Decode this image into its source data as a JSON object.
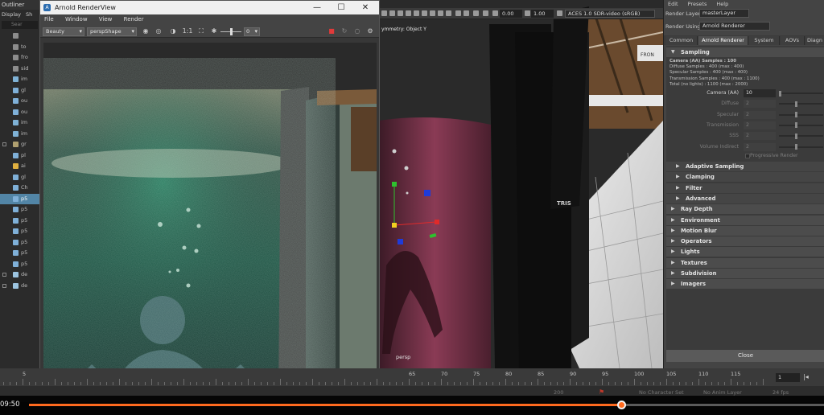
{
  "outliner": {
    "title": "Outliner",
    "menus": [
      "Display",
      "Sh"
    ],
    "search_placeholder": "Sear",
    "items": [
      {
        "label": "",
        "icon": "camera-icon"
      },
      {
        "label": "to",
        "icon": "camera-icon"
      },
      {
        "label": "fro",
        "icon": "camera-icon"
      },
      {
        "label": "sid",
        "icon": "camera-icon"
      },
      {
        "label": "im",
        "icon": "image-plane-icon"
      },
      {
        "label": "gl",
        "icon": "mesh-icon"
      },
      {
        "label": "ou",
        "icon": "mesh-icon"
      },
      {
        "label": "ou",
        "icon": "mesh-icon"
      },
      {
        "label": "im",
        "icon": "image-plane-icon"
      },
      {
        "label": "im",
        "icon": "image-plane-icon"
      },
      {
        "label": "gr",
        "icon": "group-icon"
      },
      {
        "label": "pl",
        "icon": "mesh-icon"
      },
      {
        "label": "ai",
        "icon": "light-icon"
      },
      {
        "label": "gl",
        "icon": "mesh-icon"
      },
      {
        "label": "Ch",
        "icon": "mesh-icon"
      },
      {
        "label": "p5",
        "icon": "mesh-icon"
      },
      {
        "label": "p5",
        "icon": "mesh-icon"
      },
      {
        "label": "p5",
        "icon": "mesh-icon"
      },
      {
        "label": "p5",
        "icon": "mesh-icon"
      },
      {
        "label": "p5",
        "icon": "mesh-icon"
      },
      {
        "label": "p5",
        "icon": "mesh-icon"
      },
      {
        "label": "p5",
        "icon": "mesh-icon"
      },
      {
        "label": "de",
        "icon": "set-icon"
      },
      {
        "label": "de",
        "icon": "set-icon"
      }
    ]
  },
  "render_view": {
    "title": "Arnold RenderView",
    "menus": [
      "File",
      "Window",
      "View",
      "Render"
    ],
    "aov_select": "Beauty",
    "camera_select": "perspShape",
    "ratio_label": "1:1",
    "exposure_value": "0",
    "window_controls": {
      "minimize": "—",
      "maximize": "☐",
      "close": "✕"
    }
  },
  "viewport": {
    "symmetry_label": "ymmetry: Object Y",
    "camera_label": "persp",
    "field_a": "0.00",
    "field_b": "1.00",
    "color_space": "ACES 1.0 SDR-video (sRGB)",
    "sign_text": "FRON",
    "poster_text": "TRIS"
  },
  "render_settings": {
    "menus": [
      "Edit",
      "Presets",
      "Help"
    ],
    "render_layer_label": "Render Layer",
    "render_layer_value": "masterLayer",
    "render_using_label": "Render Using",
    "render_using_value": "Arnold Renderer",
    "tabs": [
      "Common",
      "Arnold Renderer",
      "System",
      "AOVs",
      "Diagn"
    ],
    "sampling": {
      "title": "Sampling",
      "lines": [
        "Camera (AA) Samples : 100",
        "Diffuse Samples : 400 (max : 400)",
        "Specular Samples : 400 (max : 400)",
        "Transmission Samples : 400 (max : 1100)",
        "Total (no lights) : 1100 (max : 2000)"
      ],
      "fields": [
        {
          "label": "Camera (AA)",
          "value": "10",
          "enabled": true
        },
        {
          "label": "Diffuse",
          "value": "2",
          "enabled": false
        },
        {
          "label": "Specular",
          "value": "2",
          "enabled": false
        },
        {
          "label": "Transmission",
          "value": "2",
          "enabled": false
        },
        {
          "label": "SSS",
          "value": "2",
          "enabled": false
        },
        {
          "label": "Volume Indirect",
          "value": "2",
          "enabled": false
        }
      ],
      "progressive_label": "Progressive Render"
    },
    "collapsed_sections": [
      "Adaptive Sampling",
      "Clamping",
      "Filter",
      "Advanced",
      "Ray Depth",
      "Environment",
      "Motion Blur",
      "Operators",
      "Lights",
      "Textures",
      "Subdivision",
      "Imagers"
    ],
    "close_label": "Close"
  },
  "timeline": {
    "ticks": [
      "5",
      "65",
      "70",
      "75",
      "80",
      "85",
      "90",
      "95",
      "100",
      "105",
      "110",
      "115"
    ],
    "current_frame": "1",
    "range_labels": [
      "200",
      "No Character Set",
      "No Anim Layer",
      "24 fps"
    ]
  },
  "player": {
    "time": "09:50",
    "progress": 0.745
  },
  "colors": {
    "accent_orange": "#ff6a1f",
    "selection_blue": "#5285a6"
  }
}
